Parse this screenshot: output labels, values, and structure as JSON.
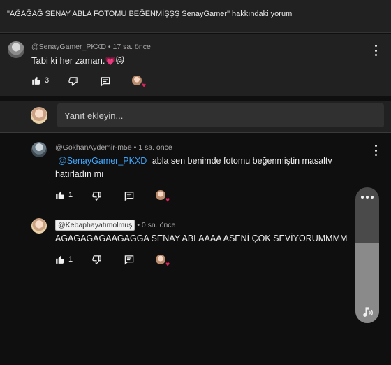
{
  "header": {
    "title": "\"AĞAĞAĞ SENAY ABLA FOTOMU BEĞENMİŞŞŞ SenayGamer\" hakkındaki yorum"
  },
  "main_comment": {
    "author": "@SenayGamer_PKXD",
    "separator": "•",
    "time": "17 sa. önce",
    "text": "Tabi ki her zaman.",
    "emojis": "💗😻",
    "like_count": "3"
  },
  "reply_bar": {
    "placeholder": "Yanıt ekleyin..."
  },
  "replies": [
    {
      "author": "@GökhanAydemir-m5e",
      "separator": "•",
      "time": "1 sa. önce",
      "mention": "@SenayGamer_PKXD",
      "text_line1": "abla sen benimde fotomu beğenmiştin masaltv",
      "text_line2": "hatırladın mı",
      "like_count": "1"
    },
    {
      "author": "@Kebaphayatımolmuş",
      "separator": "•",
      "time": "0 sn. önce",
      "text": "AGAGAGAGAAGAGGA SENAY ABLAAAA ASENİ ÇOK SEVİYORUMMMM",
      "like_count": "1"
    }
  ],
  "icons": {
    "like": "thumbs-up-icon",
    "dislike": "thumbs-down-icon",
    "reply": "comment-icon",
    "creator_heart": "creator-heart-icon",
    "more": "more-vert-icon",
    "scroll_audio": "audio-note-icon"
  },
  "colors": {
    "background": "#0f0f0f",
    "panel": "#212121",
    "mention": "#3ea6ff",
    "heart": "#e0245e"
  }
}
